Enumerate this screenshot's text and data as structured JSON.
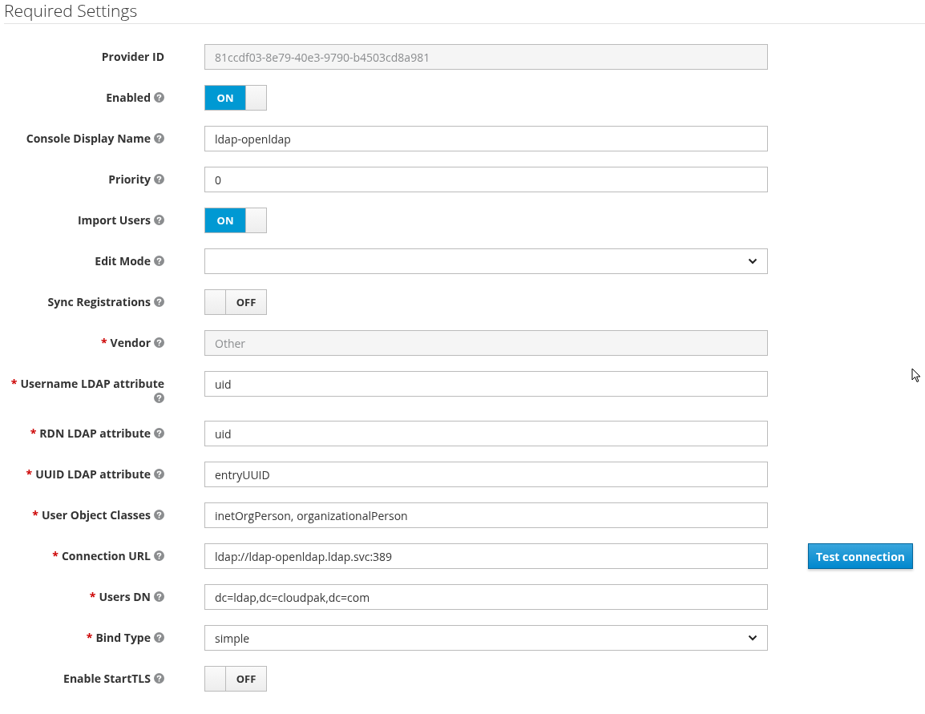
{
  "heading": "Required Settings",
  "fields": [
    {
      "label": "Provider ID",
      "help": false,
      "kind": "readonly",
      "value": "81ccdf03-8e79-40e3-9790-b4503cd8a981"
    },
    {
      "label": "Enabled",
      "help": true,
      "kind": "toggle",
      "on": true,
      "state_text": "ON"
    },
    {
      "label": "Console Display Name",
      "help": true,
      "kind": "text",
      "value": "ldap-openldap"
    },
    {
      "label": "Priority",
      "help": true,
      "kind": "text",
      "value": "0"
    },
    {
      "label": "Import Users",
      "help": true,
      "kind": "toggle",
      "on": true,
      "state_text": "ON"
    },
    {
      "label": "Edit Mode",
      "help": true,
      "kind": "select"
    },
    {
      "label": "Sync Registrations",
      "help": true,
      "kind": "toggle",
      "on": false,
      "state_text": "OFF"
    },
    {
      "label": "Vendor",
      "marker": "*",
      "help": true,
      "kind": "readonly",
      "value": "Other"
    },
    {
      "label": "Username LDAP attribute",
      "marker": "*",
      "help": true,
      "kind": "text",
      "value": "uid"
    },
    {
      "label": "RDN LDAP attribute",
      "marker": "*",
      "help": true,
      "kind": "text",
      "value": "uid"
    },
    {
      "label": "UUID LDAP attribute",
      "marker": "*",
      "help": true,
      "kind": "text",
      "value": "entryUUID"
    },
    {
      "label": "User Object Classes",
      "marker": "*",
      "help": true,
      "kind": "text",
      "value": "inetOrgPerson, organizationalPerson"
    },
    {
      "label": "Connection URL",
      "marker": "*",
      "help": true,
      "kind": "text",
      "value": "ldap://ldap-openldap.ldap.svc:389",
      "button": "Test connection"
    },
    {
      "label": "Users DN",
      "marker": "*",
      "help": true,
      "kind": "text",
      "value": "dc=ldap,dc=cloudpak,dc=com"
    },
    {
      "label": "Bind Type",
      "marker": "*",
      "help": true,
      "kind": "select",
      "value": "simple"
    },
    {
      "label": "Enable StartTLS",
      "help": true,
      "kind": "toggle",
      "on": false,
      "state_text": "OFF"
    }
  ]
}
